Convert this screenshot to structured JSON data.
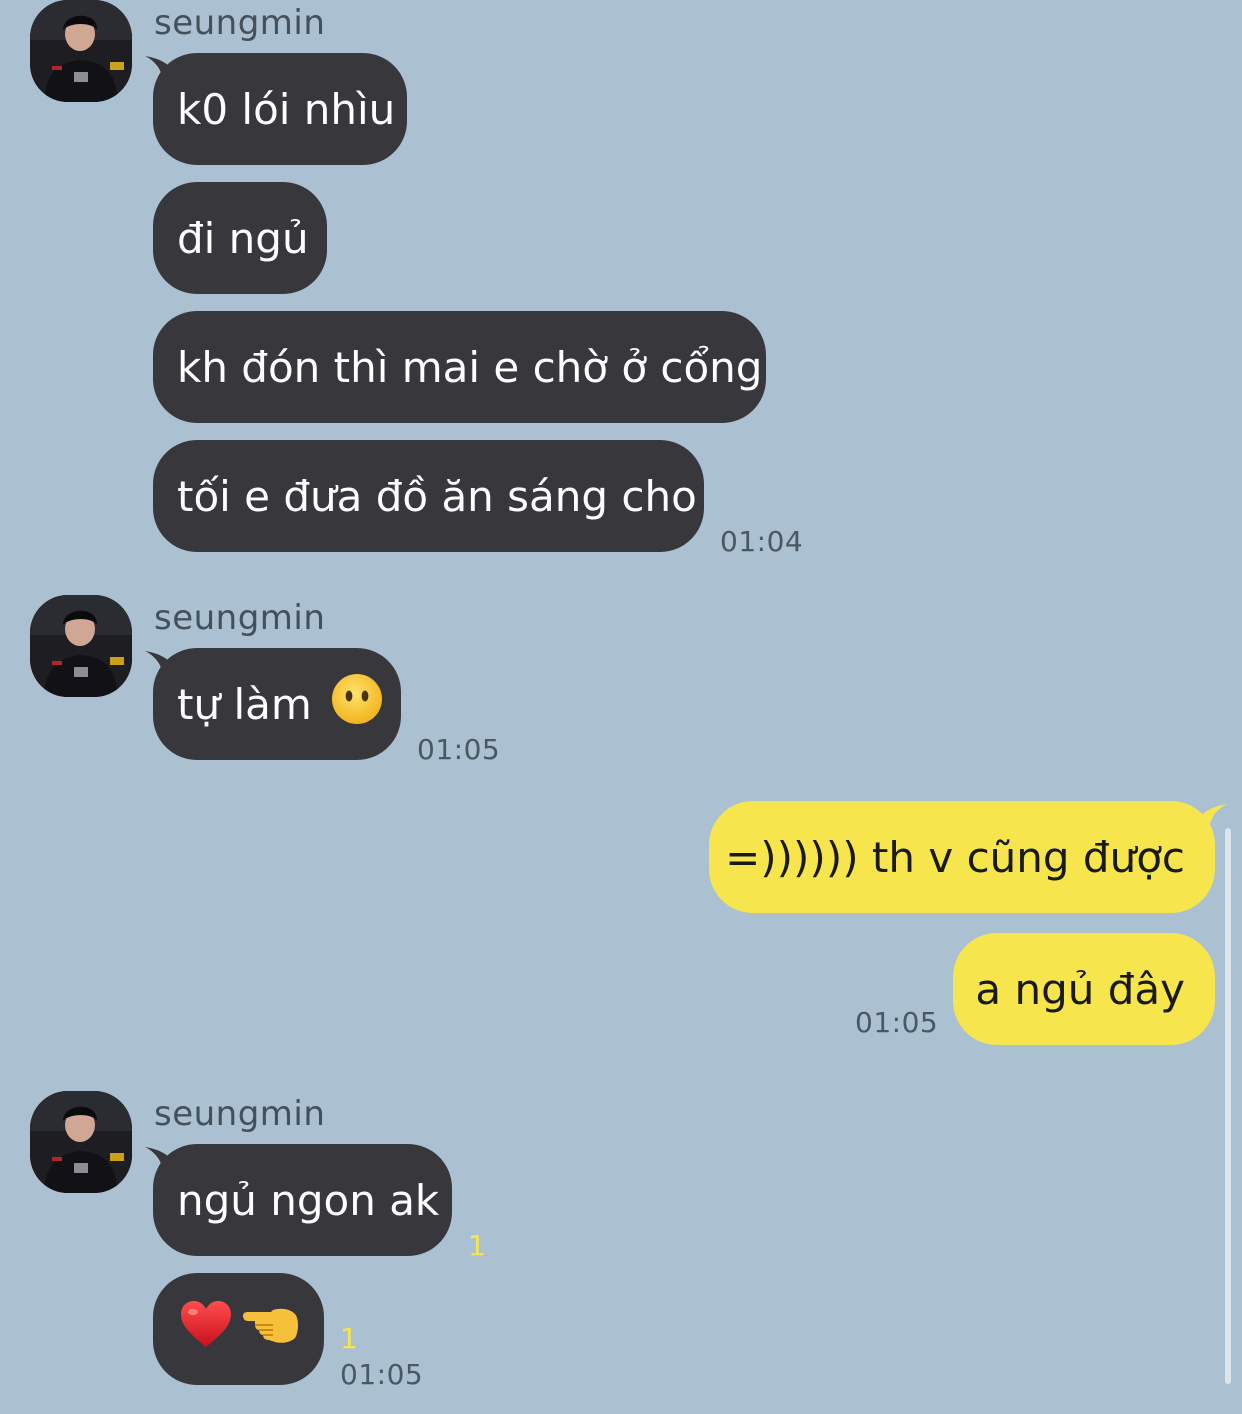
{
  "colors": {
    "background": "#abc1d1",
    "incoming_bubble": "#38383c",
    "outgoing_bubble": "#f7e54d",
    "unread_count": "#f7e54d"
  },
  "groups": [
    {
      "sender": "seungmin",
      "avatar_icon": "profile-photo",
      "messages": [
        "k0 lói nhìu",
        "đi ngủ",
        "kh đón thì mai e chờ ở cổng",
        "tối e đưa đồ ăn sáng cho"
      ],
      "time": "01:04"
    },
    {
      "sender": "seungmin",
      "avatar_icon": "profile-photo",
      "message_text": "tự làm",
      "message_emoji": "face-without-mouth",
      "time": "01:05"
    }
  ],
  "outgoing": {
    "messages": [
      "=)))))) th v cũng được",
      "a ngủ đây"
    ],
    "time": "01:05"
  },
  "last_group": {
    "sender": "seungmin",
    "avatar_icon": "profile-photo",
    "messages": [
      "ngủ ngon ak"
    ],
    "emoji_message": [
      "red-heart",
      "backhand-index-pointing-left"
    ],
    "unread": [
      "1",
      "1"
    ],
    "time": "01:05"
  }
}
